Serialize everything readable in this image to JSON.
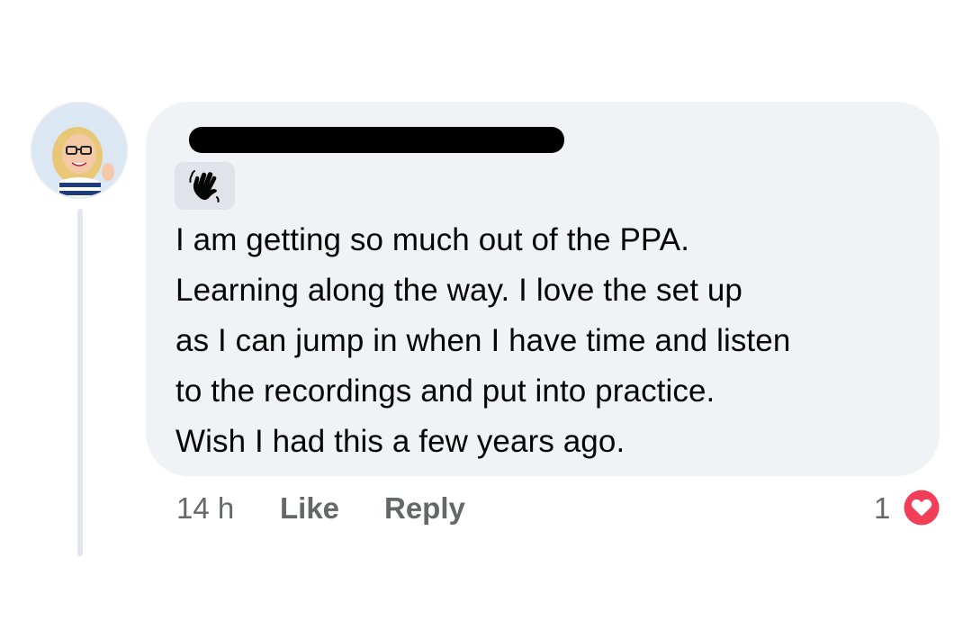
{
  "comment": {
    "author_name": "",
    "badge_icon": "waving-hand-icon",
    "text_lines": [
      "I am getting so much out of the PPA.",
      "Learning along the way.  I love the set up",
      "as I can jump in when I have time and listen",
      "to the recordings and put into practice.",
      "Wish I had this a few years ago."
    ],
    "timestamp": "14 h",
    "like_label": "Like",
    "reply_label": "Reply",
    "reaction_count": "1",
    "reaction_icon": "heart-reaction-icon",
    "colors": {
      "bubble": "#f0f2f5",
      "text": "#050505",
      "meta": "#65676b",
      "heart": "#f33e58",
      "redaction": "#000000"
    }
  }
}
